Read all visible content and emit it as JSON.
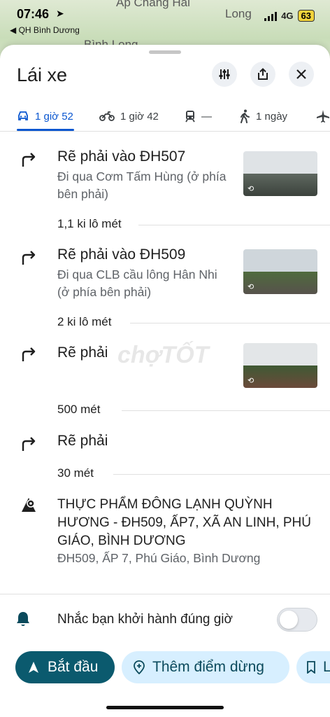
{
  "status": {
    "time": "07:46",
    "back_label": "◀ QH Bình Dương",
    "network": "4G",
    "battery": "63"
  },
  "map": {
    "labels": [
      "Ấp Chàng Hai",
      "Long",
      "Bình Long"
    ]
  },
  "header": {
    "title": "Lái xe",
    "icons": [
      "tune-icon",
      "share-icon",
      "close-icon"
    ]
  },
  "tabs": [
    {
      "mode": "car",
      "label": "1 giờ 52",
      "active": true
    },
    {
      "mode": "motorbike",
      "label": "1 giờ 42",
      "active": false
    },
    {
      "mode": "transit",
      "label": "—",
      "active": false
    },
    {
      "mode": "walk",
      "label": "1 ngày",
      "active": false
    },
    {
      "mode": "flight",
      "label": "",
      "active": false
    }
  ],
  "steps": [
    {
      "instruction": "Rẽ phải vào ĐH507",
      "detail": "Đi qua Cơm Tấm Hùng (ở phía bên phải)",
      "distance": "1,1 ki lô mét"
    },
    {
      "instruction": "Rẽ phải vào ĐH509",
      "detail": "Đi qua CLB cầu lông Hân Nhi (ở phía bên phải)",
      "distance": "2 ki lô mét"
    },
    {
      "instruction": "Rẽ phải",
      "detail": "",
      "distance": "500 mét"
    },
    {
      "instruction": "Rẽ phải",
      "detail": "",
      "distance": "30 mét"
    }
  ],
  "destination": {
    "name": "THỰC PHẨM ĐÔNG LẠNH QUỲNH HƯƠNG - ĐH509, ẤP7, XÃ AN LINH, PHÚ GIÁO, BÌNH DƯƠNG",
    "address": "ĐH509, ẤP 7, Phú Giáo, Bình Dương"
  },
  "reminder": {
    "label": "Nhắc bạn khởi hành đúng giờ",
    "enabled": false
  },
  "actions": {
    "start_label": "Bắt đầu",
    "add_stop_label": "Thêm điểm dừng",
    "more_label": "L"
  },
  "watermark": "chợTỐT",
  "colors": {
    "accent": "#0b57d0",
    "start_button": "#0b5a6e",
    "secondary_button": "#d7efff"
  }
}
